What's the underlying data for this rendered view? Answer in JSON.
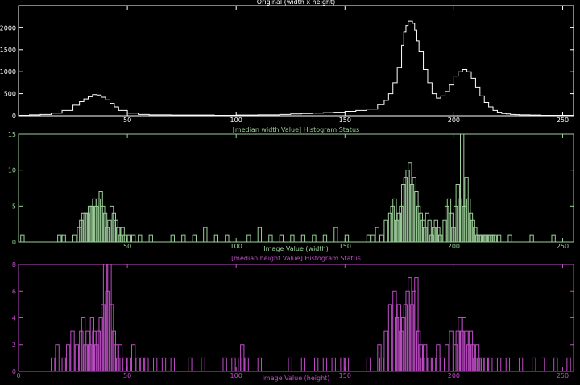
{
  "chart_data": [
    {
      "type": "line",
      "title": "Original (width x height)",
      "xlabel": "",
      "ylabel": "",
      "color": "#ffffff",
      "xlim": [
        0,
        255
      ],
      "ylim": [
        0,
        2500
      ],
      "xticks": [
        "50",
        "100",
        "150",
        "200",
        "250"
      ],
      "yticks": [
        "0",
        "500",
        "1000",
        "1500",
        "2000"
      ],
      "series": [
        {
          "x": [
            0,
            5,
            10,
            15,
            20,
            25,
            28,
            30,
            32,
            34,
            36,
            38,
            40,
            42,
            44,
            46,
            50,
            55,
            60,
            70,
            80,
            90,
            100,
            110,
            120,
            125,
            130,
            135,
            140,
            145,
            150,
            155,
            160,
            165,
            168,
            170,
            172,
            174,
            176,
            177,
            178,
            179,
            180,
            181,
            182,
            183,
            184,
            186,
            188,
            190,
            192,
            194,
            196,
            198,
            200,
            202,
            204,
            206,
            208,
            210,
            212,
            214,
            216,
            218,
            220,
            222,
            224,
            226,
            228,
            230,
            235,
            240,
            245,
            250,
            255
          ],
          "y": [
            10,
            20,
            30,
            60,
            120,
            240,
            320,
            380,
            430,
            480,
            470,
            420,
            360,
            280,
            200,
            120,
            60,
            30,
            20,
            15,
            15,
            10,
            15,
            20,
            30,
            40,
            50,
            60,
            70,
            80,
            100,
            120,
            150,
            250,
            350,
            500,
            750,
            1100,
            1600,
            1900,
            2050,
            2150,
            2150,
            2100,
            1950,
            1700,
            1450,
            1050,
            750,
            500,
            400,
            450,
            550,
            700,
            900,
            1000,
            1050,
            1000,
            850,
            650,
            450,
            300,
            200,
            120,
            80,
            50,
            40,
            30,
            25,
            20,
            15,
            10,
            10,
            10,
            10
          ]
        }
      ]
    },
    {
      "type": "bar",
      "title": "[median width Value] Histogram Status",
      "xlabel": "Image Value (width)",
      "ylabel": "",
      "color": "#9ccf9a",
      "xlim": [
        0,
        255
      ],
      "ylim": [
        0,
        15
      ],
      "xticks": [
        "50",
        "100",
        "150",
        "200",
        "250"
      ],
      "yticks": [
        "0",
        "5",
        "10",
        "15"
      ],
      "series": [
        {
          "x": [
            1,
            18,
            20,
            25,
            27,
            28,
            29,
            30,
            31,
            32,
            33,
            34,
            35,
            36,
            37,
            38,
            39,
            40,
            41,
            42,
            43,
            44,
            45,
            46,
            47,
            48,
            50,
            52,
            55,
            60,
            70,
            75,
            80,
            85,
            90,
            95,
            105,
            110,
            115,
            120,
            125,
            130,
            135,
            140,
            145,
            150,
            160,
            162,
            164,
            166,
            168,
            170,
            171,
            172,
            173,
            174,
            175,
            176,
            177,
            178,
            179,
            180,
            181,
            182,
            183,
            184,
            185,
            186,
            187,
            188,
            189,
            190,
            191,
            192,
            193,
            194,
            195,
            196,
            197,
            198,
            199,
            200,
            201,
            202,
            203,
            204,
            205,
            206,
            207,
            208,
            209,
            210,
            211,
            212,
            213,
            214,
            215,
            216,
            217,
            218,
            220,
            225,
            235,
            245
          ],
          "y": [
            1,
            1,
            1,
            1,
            2,
            3,
            4,
            4,
            4,
            5,
            5,
            6,
            5,
            6,
            7,
            5,
            4,
            2,
            3,
            5,
            4,
            3,
            2,
            1,
            2,
            1,
            1,
            1,
            1,
            1,
            1,
            1,
            1,
            2,
            1,
            1,
            1,
            2,
            1,
            1,
            1,
            1,
            1,
            1,
            2,
            1,
            1,
            1,
            2,
            1,
            3,
            4,
            5,
            6,
            3,
            4,
            5,
            8,
            9,
            10,
            11,
            8,
            9,
            7,
            5,
            4,
            3,
            2,
            4,
            3,
            1,
            2,
            3,
            2,
            1,
            0,
            3,
            5,
            6,
            4,
            2,
            5,
            8,
            6,
            15,
            5,
            9,
            6,
            4,
            3,
            2,
            1,
            1,
            1,
            1,
            1,
            1,
            1,
            1,
            1,
            1,
            1,
            1,
            1
          ]
        }
      ]
    },
    {
      "type": "bar",
      "title": "[median height Value] Histogram Status",
      "xlabel": "Image Value (height)",
      "ylabel": "",
      "color": "#c04dc8",
      "xlim": [
        0,
        255
      ],
      "ylim": [
        0,
        8
      ],
      "xticks": [
        "0",
        "50",
        "100",
        "150",
        "200",
        "250"
      ],
      "yticks": [
        "0",
        "2",
        "4",
        "6",
        "8"
      ],
      "series": [
        {
          "x": [
            15,
            17,
            20,
            22,
            24,
            26,
            28,
            29,
            30,
            31,
            32,
            33,
            34,
            35,
            36,
            37,
            38,
            39,
            40,
            41,
            42,
            43,
            44,
            45,
            46,
            48,
            50,
            52,
            54,
            56,
            58,
            62,
            66,
            70,
            78,
            84,
            94,
            98,
            101,
            102,
            104,
            110,
            124,
            130,
            136,
            140,
            144,
            148,
            150,
            160,
            165,
            166,
            168,
            170,
            172,
            173,
            174,
            175,
            176,
            177,
            178,
            179,
            180,
            181,
            182,
            183,
            184,
            185,
            186,
            188,
            190,
            192,
            194,
            196,
            198,
            200,
            201,
            202,
            203,
            204,
            205,
            206,
            207,
            208,
            209,
            210,
            211,
            212,
            214,
            216,
            220,
            224,
            230,
            236,
            240,
            246,
            252
          ],
          "y": [
            1,
            2,
            1,
            2,
            3,
            2,
            3,
            4,
            2,
            3,
            2,
            4,
            3,
            2,
            3,
            4,
            5,
            8,
            6,
            8,
            5,
            3,
            2,
            1,
            2,
            1,
            1,
            2,
            1,
            1,
            1,
            1,
            1,
            1,
            1,
            1,
            1,
            1,
            1,
            2,
            1,
            1,
            1,
            1,
            1,
            1,
            1,
            1,
            1,
            1,
            2,
            1,
            3,
            5,
            6,
            4,
            5,
            3,
            4,
            5,
            6,
            7,
            5,
            6,
            7,
            3,
            2,
            1,
            2,
            1,
            1,
            2,
            1,
            2,
            3,
            2,
            3,
            4,
            3,
            4,
            3,
            2,
            3,
            2,
            1,
            2,
            1,
            1,
            1,
            1,
            1,
            1,
            1,
            1,
            1,
            1,
            1
          ]
        }
      ]
    }
  ]
}
